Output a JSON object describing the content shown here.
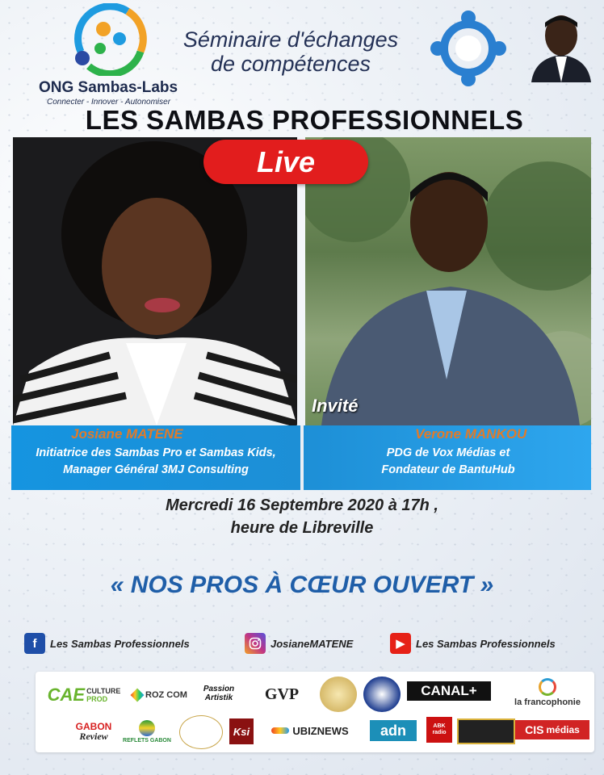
{
  "header": {
    "org_name": "ONG Sambas-Labs",
    "org_tagline": "Connecter - Innover - Autonomiser",
    "seminar_line1": "Séminaire d'échanges",
    "seminar_line2": "de compétences",
    "main_title": "LES SAMBAS PROFESSIONNELS"
  },
  "live_badge": "Live",
  "invite_label": "Invité",
  "host": {
    "name": "Josiane MATENE",
    "role_line1": "Initiatrice des Sambas Pro et Sambas Kids,",
    "role_line2": "Manager Général 3MJ Consulting"
  },
  "guest": {
    "name": "Verone MANKOU",
    "role_line1": "PDG de Vox Médias et",
    "role_line2": "Fondateur de BantuHub"
  },
  "event": {
    "date_line": "Mercredi 16 Septembre 2020 à 17h ,",
    "time_zone_line": "heure de Libreville"
  },
  "slogan": "« NOS PROS À CŒUR OUVERT »",
  "socials": [
    {
      "platform": "facebook",
      "label": "Les Sambas Professionnels",
      "color": "#1f4fa8"
    },
    {
      "platform": "instagram",
      "label": "JosianeMATENE",
      "color": "#c13584"
    },
    {
      "platform": "youtube",
      "label": "Les Sambas Professionnels",
      "color": "#e62117"
    }
  ],
  "sponsors": {
    "row1": [
      "CAE",
      "CULTURE",
      "PROD",
      "ROZ COM",
      "Passion Artistik",
      "GVP",
      "CANAL+",
      "la francophonie"
    ],
    "row2": [
      "GABON",
      "Review",
      "REFLETS GABON",
      "Ksi",
      "UBIZNEWS",
      "adn",
      "ABK radio",
      "CIS",
      "médias"
    ]
  },
  "colors": {
    "accent_blue": "#1d8fd6",
    "live_red": "#e21d1d",
    "name_orange": "#e07b2a",
    "slogan_blue": "#1f5ea8"
  }
}
